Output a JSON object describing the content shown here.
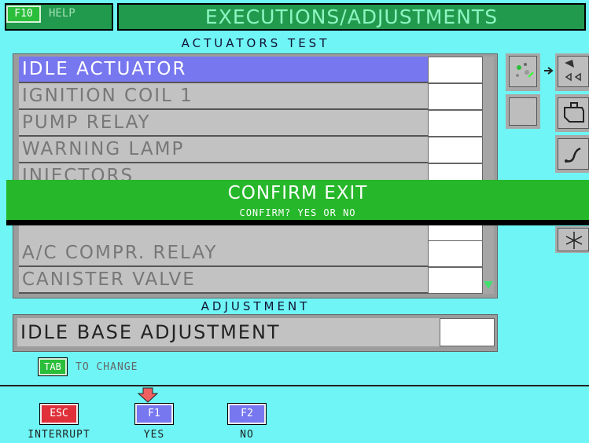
{
  "header": {
    "help_key": "F10",
    "help_label": "HELP",
    "title": "EXECUTIONS/ADJUSTMENTS"
  },
  "actuators": {
    "section_title": "ACTUATORS TEST",
    "items": [
      {
        "label": "IDLE ACTUATOR",
        "selected": true
      },
      {
        "label": "IGNITION COIL 1"
      },
      {
        "label": "PUMP RELAY"
      },
      {
        "label": "WARNING LAMP"
      },
      {
        "label": "INJECTORS"
      },
      {
        "label": "A/C COMPR. RELAY"
      },
      {
        "label": "CANISTER VALVE"
      }
    ]
  },
  "dialog": {
    "title": "CONFIRM EXIT",
    "subtitle": "CONFIRM? YES OR NO"
  },
  "adjustment": {
    "section_title": "ADJUSTMENT",
    "item": "IDLE BASE ADJUSTMENT"
  },
  "footer": {
    "tab_key": "TAB",
    "tab_hint": "TO CHANGE",
    "keys": [
      {
        "key": "ESC",
        "label": "INTERRUPT",
        "color": "#E0303A"
      },
      {
        "key": "F1",
        "label": "YES",
        "color": "#7777F0"
      },
      {
        "key": "F2",
        "label": "NO",
        "color": "#7777F0"
      }
    ]
  },
  "icons": [
    "gear-arrow-icon",
    "actuator-icon",
    "engine-icon",
    "wrench-curve-icon",
    "fan-icon"
  ]
}
